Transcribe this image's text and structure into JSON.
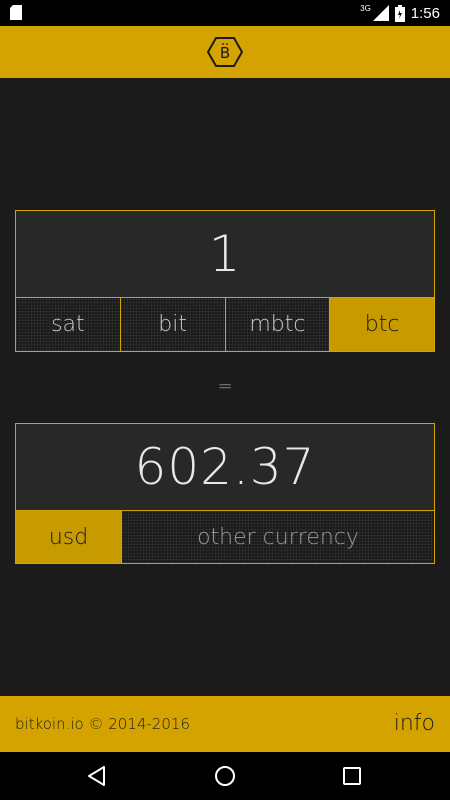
{
  "status_bar": {
    "network": "3G",
    "time": "1:56"
  },
  "converter": {
    "input_value": "1",
    "units": [
      "sat",
      "bit",
      "mbtc",
      "btc"
    ],
    "selected_unit": "btc",
    "equals": "=",
    "output_value": "602.37",
    "currency_selected": "usd",
    "currency_other": "other currency"
  },
  "footer": {
    "copyright": "bitkoin.io © 2014-2016",
    "info": "info"
  },
  "colors": {
    "accent": "#d4a300",
    "background": "#1b1b1b"
  }
}
